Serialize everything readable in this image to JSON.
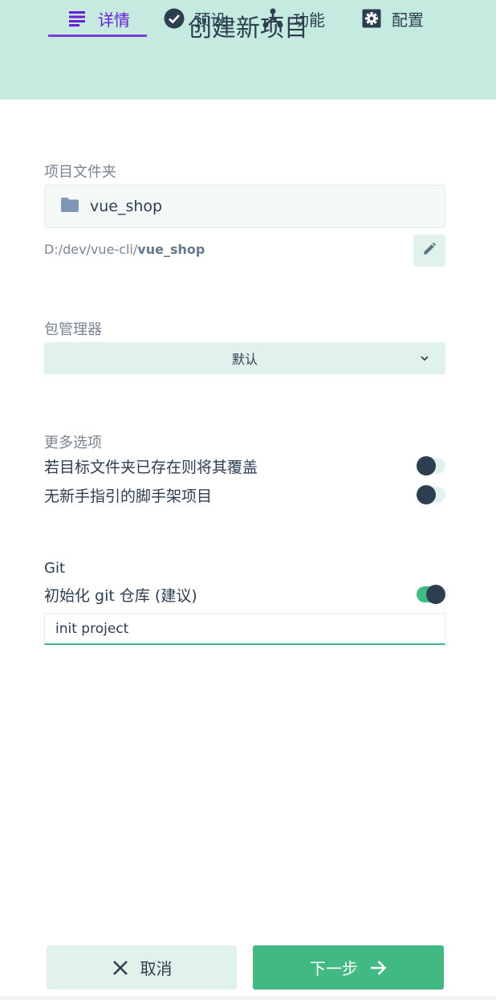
{
  "header": {
    "title": "创建新项目",
    "tabs": [
      {
        "label": "详情",
        "icon": "list-icon",
        "active": true
      },
      {
        "label": "预设",
        "icon": "check-circle-icon",
        "active": false
      },
      {
        "label": "功能",
        "icon": "merge-icon",
        "active": false
      },
      {
        "label": "配置",
        "icon": "gear-icon",
        "active": false
      }
    ]
  },
  "folder": {
    "label": "项目文件夹",
    "value": "vue_shop",
    "path_prefix": "D:/dev/vue-cli/",
    "path_name": "vue_shop"
  },
  "package_manager": {
    "label": "包管理器",
    "selected": "默认"
  },
  "more_options": {
    "label": "更多选项",
    "items": [
      {
        "label": "若目标文件夹已存在则将其覆盖",
        "enabled": false
      },
      {
        "label": "无新手指引的脚手架项目",
        "enabled": false
      }
    ]
  },
  "git": {
    "label": "Git",
    "init_label": "初始化 git 仓库 (建议)",
    "init_enabled": true,
    "commit_message": "init project"
  },
  "footer": {
    "cancel_label": "取消",
    "next_label": "下一步"
  },
  "colors": {
    "header_bg": "#c5eadf",
    "accent_green": "#42b983",
    "active_tab": "#6a1fd6",
    "text_dark": "#2c3e50"
  }
}
